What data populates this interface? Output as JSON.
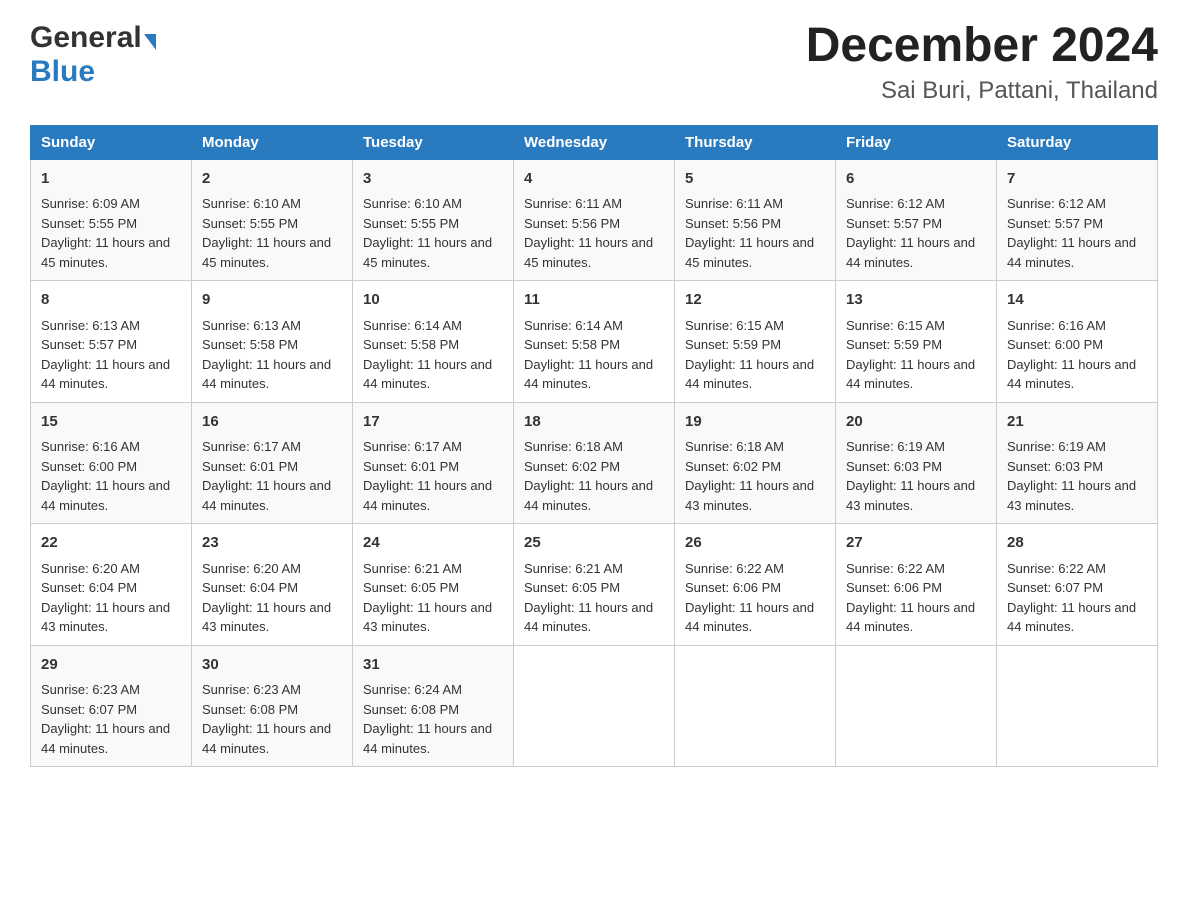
{
  "header": {
    "logo_general": "General",
    "logo_blue": "Blue",
    "title": "December 2024",
    "subtitle": "Sai Buri, Pattani, Thailand"
  },
  "weekdays": [
    "Sunday",
    "Monday",
    "Tuesday",
    "Wednesday",
    "Thursday",
    "Friday",
    "Saturday"
  ],
  "weeks": [
    [
      {
        "day": "1",
        "sunrise": "6:09 AM",
        "sunset": "5:55 PM",
        "daylight": "11 hours and 45 minutes."
      },
      {
        "day": "2",
        "sunrise": "6:10 AM",
        "sunset": "5:55 PM",
        "daylight": "11 hours and 45 minutes."
      },
      {
        "day": "3",
        "sunrise": "6:10 AM",
        "sunset": "5:55 PM",
        "daylight": "11 hours and 45 minutes."
      },
      {
        "day": "4",
        "sunrise": "6:11 AM",
        "sunset": "5:56 PM",
        "daylight": "11 hours and 45 minutes."
      },
      {
        "day": "5",
        "sunrise": "6:11 AM",
        "sunset": "5:56 PM",
        "daylight": "11 hours and 45 minutes."
      },
      {
        "day": "6",
        "sunrise": "6:12 AM",
        "sunset": "5:57 PM",
        "daylight": "11 hours and 44 minutes."
      },
      {
        "day": "7",
        "sunrise": "6:12 AM",
        "sunset": "5:57 PM",
        "daylight": "11 hours and 44 minutes."
      }
    ],
    [
      {
        "day": "8",
        "sunrise": "6:13 AM",
        "sunset": "5:57 PM",
        "daylight": "11 hours and 44 minutes."
      },
      {
        "day": "9",
        "sunrise": "6:13 AM",
        "sunset": "5:58 PM",
        "daylight": "11 hours and 44 minutes."
      },
      {
        "day": "10",
        "sunrise": "6:14 AM",
        "sunset": "5:58 PM",
        "daylight": "11 hours and 44 minutes."
      },
      {
        "day": "11",
        "sunrise": "6:14 AM",
        "sunset": "5:58 PM",
        "daylight": "11 hours and 44 minutes."
      },
      {
        "day": "12",
        "sunrise": "6:15 AM",
        "sunset": "5:59 PM",
        "daylight": "11 hours and 44 minutes."
      },
      {
        "day": "13",
        "sunrise": "6:15 AM",
        "sunset": "5:59 PM",
        "daylight": "11 hours and 44 minutes."
      },
      {
        "day": "14",
        "sunrise": "6:16 AM",
        "sunset": "6:00 PM",
        "daylight": "11 hours and 44 minutes."
      }
    ],
    [
      {
        "day": "15",
        "sunrise": "6:16 AM",
        "sunset": "6:00 PM",
        "daylight": "11 hours and 44 minutes."
      },
      {
        "day": "16",
        "sunrise": "6:17 AM",
        "sunset": "6:01 PM",
        "daylight": "11 hours and 44 minutes."
      },
      {
        "day": "17",
        "sunrise": "6:17 AM",
        "sunset": "6:01 PM",
        "daylight": "11 hours and 44 minutes."
      },
      {
        "day": "18",
        "sunrise": "6:18 AM",
        "sunset": "6:02 PM",
        "daylight": "11 hours and 44 minutes."
      },
      {
        "day": "19",
        "sunrise": "6:18 AM",
        "sunset": "6:02 PM",
        "daylight": "11 hours and 43 minutes."
      },
      {
        "day": "20",
        "sunrise": "6:19 AM",
        "sunset": "6:03 PM",
        "daylight": "11 hours and 43 minutes."
      },
      {
        "day": "21",
        "sunrise": "6:19 AM",
        "sunset": "6:03 PM",
        "daylight": "11 hours and 43 minutes."
      }
    ],
    [
      {
        "day": "22",
        "sunrise": "6:20 AM",
        "sunset": "6:04 PM",
        "daylight": "11 hours and 43 minutes."
      },
      {
        "day": "23",
        "sunrise": "6:20 AM",
        "sunset": "6:04 PM",
        "daylight": "11 hours and 43 minutes."
      },
      {
        "day": "24",
        "sunrise": "6:21 AM",
        "sunset": "6:05 PM",
        "daylight": "11 hours and 43 minutes."
      },
      {
        "day": "25",
        "sunrise": "6:21 AM",
        "sunset": "6:05 PM",
        "daylight": "11 hours and 44 minutes."
      },
      {
        "day": "26",
        "sunrise": "6:22 AM",
        "sunset": "6:06 PM",
        "daylight": "11 hours and 44 minutes."
      },
      {
        "day": "27",
        "sunrise": "6:22 AM",
        "sunset": "6:06 PM",
        "daylight": "11 hours and 44 minutes."
      },
      {
        "day": "28",
        "sunrise": "6:22 AM",
        "sunset": "6:07 PM",
        "daylight": "11 hours and 44 minutes."
      }
    ],
    [
      {
        "day": "29",
        "sunrise": "6:23 AM",
        "sunset": "6:07 PM",
        "daylight": "11 hours and 44 minutes."
      },
      {
        "day": "30",
        "sunrise": "6:23 AM",
        "sunset": "6:08 PM",
        "daylight": "11 hours and 44 minutes."
      },
      {
        "day": "31",
        "sunrise": "6:24 AM",
        "sunset": "6:08 PM",
        "daylight": "11 hours and 44 minutes."
      },
      null,
      null,
      null,
      null
    ]
  ],
  "labels": {
    "sunrise": "Sunrise:",
    "sunset": "Sunset:",
    "daylight": "Daylight:"
  },
  "colors": {
    "header_bg": "#2a7abf",
    "header_text": "#ffffff",
    "accent_blue": "#1a6faf"
  }
}
